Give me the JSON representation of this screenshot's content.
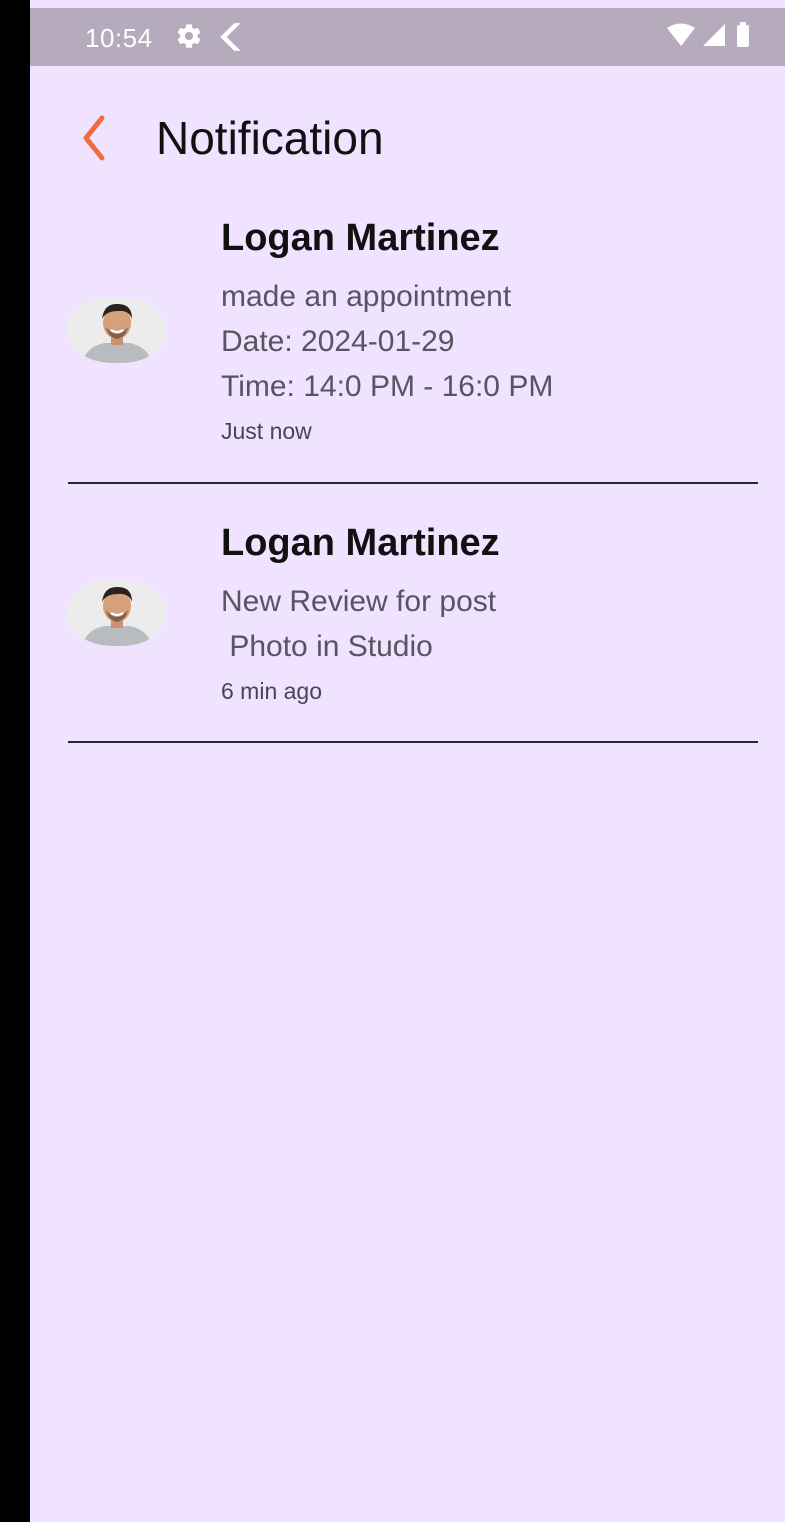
{
  "status_bar": {
    "time": "10:54",
    "icons": [
      "gear-icon",
      "flutter-icon",
      "wifi-icon",
      "signal-icon",
      "battery-icon"
    ]
  },
  "header": {
    "back_icon": "chevron-left-icon",
    "title": "Notification",
    "accent_color": "#f26a3d"
  },
  "notifications": [
    {
      "name": "Logan Martinez",
      "lines": [
        "made an appointment",
        "Date: 2024-01-29",
        "Time: 14:0 PM - 16:0 PM"
      ],
      "time": "Just now"
    },
    {
      "name": "Logan Martinez",
      "lines": [
        "New Review for post",
        " Photo in Studio"
      ],
      "time": "6 min ago"
    }
  ],
  "colors": {
    "background": "#efe3ff",
    "status_bar": "#b6aabd",
    "divider": "#2a2630"
  }
}
